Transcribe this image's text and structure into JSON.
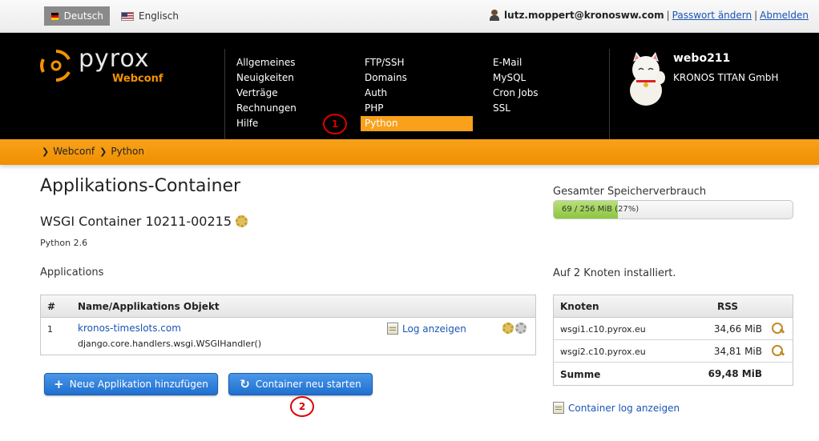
{
  "topbar": {
    "lang_active": "Deutsch",
    "lang_other": "Englisch",
    "user_email": "lutz.moppert@kronosww.com",
    "link_password": "Passwort ändern",
    "link_logout": "Abmelden",
    "separator": "|"
  },
  "logo": {
    "brand": "pyrox",
    "sub": "Webconf"
  },
  "nav": {
    "col1": [
      "Allgemeines",
      "Neuigkeiten",
      "Verträge",
      "Rechnungen",
      "Hilfe"
    ],
    "col2": [
      "FTP/SSH",
      "Domains",
      "Auth",
      "PHP",
      "Python"
    ],
    "col3": [
      "E-Mail",
      "MySQL",
      "Cron Jobs",
      "SSL"
    ],
    "active": "Python"
  },
  "markers": [
    "1",
    "2"
  ],
  "account": {
    "name": "webo211",
    "company": "KRONOS TITAN GmbH"
  },
  "breadcrumb": [
    "Webconf",
    "Python"
  ],
  "main": {
    "page_title": "Applikations-Container",
    "container_title": "WSGI Container 10211-00215",
    "python_version": "Python 2.6",
    "apps_heading": "Applications",
    "table_headers": [
      "#",
      "Name/Applikations Objekt"
    ],
    "apps": [
      {
        "num": "1",
        "name": "kronos-timeslots.com",
        "handler": "django.core.handlers.wsgi.WSGIHandler()",
        "log_label": "Log anzeigen"
      }
    ],
    "btn_add": "Neue Applikation hinzufügen",
    "btn_restart": "Container neu starten"
  },
  "side": {
    "mem_heading": "Gesamter Speicherverbrauch",
    "mem_text": "69 / 256 MiB (27%)",
    "mem_fraction": 0.27,
    "nodes_heading": "Auf 2 Knoten installiert.",
    "node_headers": [
      "Knoten",
      "RSS"
    ],
    "nodes": [
      {
        "name": "wsgi1.c10.pyrox.eu",
        "rss": "34,66 MiB"
      },
      {
        "name": "wsgi2.c10.pyrox.eu",
        "rss": "34,81 MiB"
      }
    ],
    "sum_label": "Summe",
    "sum_value": "69,48 MiB",
    "container_log": "Container log anzeigen"
  },
  "colors": {
    "accent": "#f39200",
    "link": "#1a55b5",
    "button": "#1f6fd0",
    "marker": "#dd0000"
  }
}
